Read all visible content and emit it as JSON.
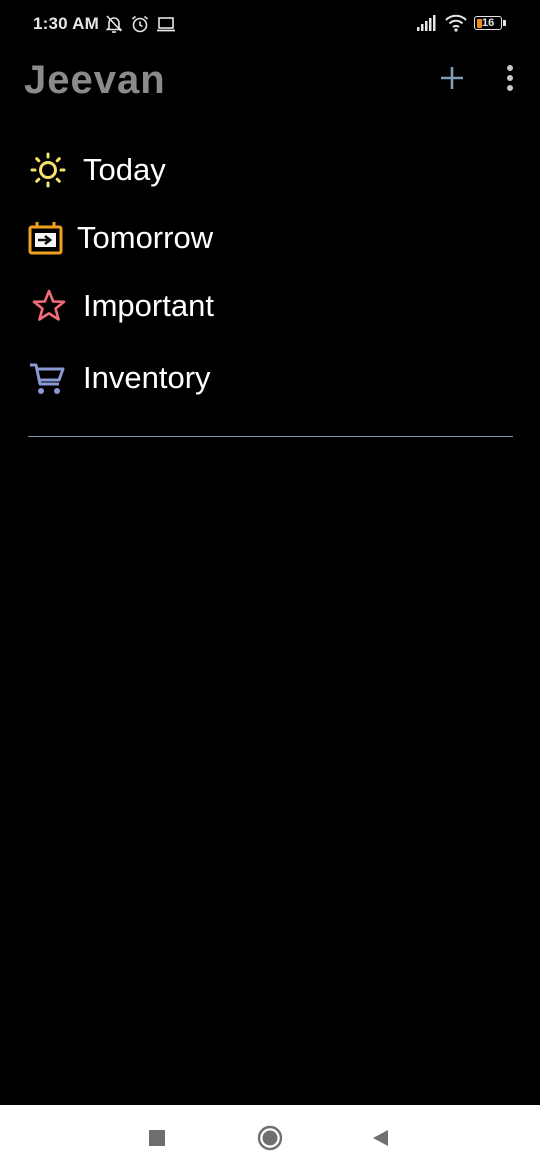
{
  "status_bar": {
    "time": "1:30 AM",
    "battery": "16",
    "icons": [
      "mute-notifications-icon",
      "alarm-icon",
      "cast-icon",
      "signal-icon",
      "wifi-icon",
      "battery-icon"
    ]
  },
  "app_bar": {
    "title": "Jeevan",
    "actions": [
      "add-icon",
      "more-vert-icon"
    ]
  },
  "menu": {
    "items": [
      {
        "label": "Today",
        "icon": "sun-icon",
        "color": "#f7e36b"
      },
      {
        "label": "Tomorrow",
        "icon": "calendar-arrow-icon",
        "color": "#f0a020"
      },
      {
        "label": "Important",
        "icon": "star-icon",
        "color": "#f36c7a"
      },
      {
        "label": "Inventory",
        "icon": "cart-icon",
        "color": "#8a98d4"
      }
    ]
  },
  "nav_bar": {
    "buttons": [
      "recents-square-icon",
      "home-circle-icon",
      "back-triangle-icon"
    ]
  }
}
